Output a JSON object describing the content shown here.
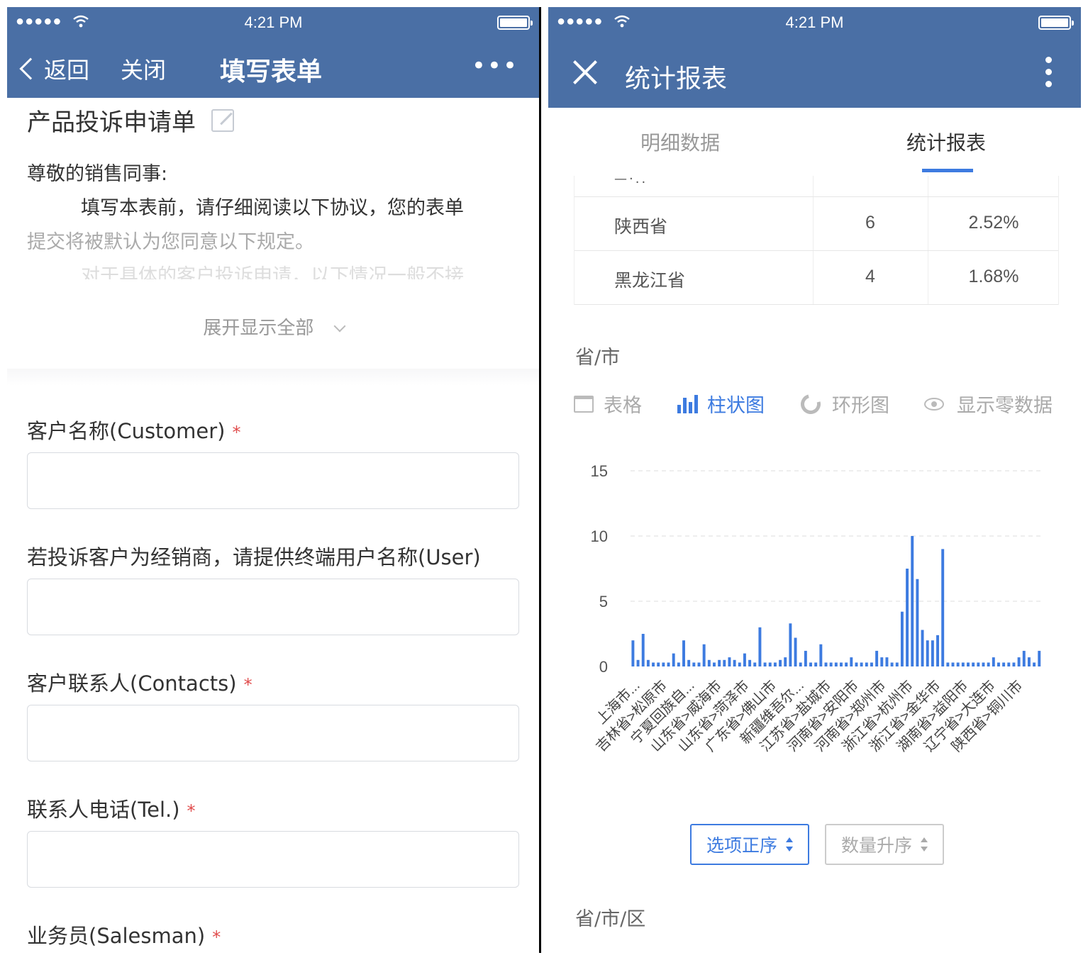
{
  "left": {
    "status": {
      "signal": "●●●●●",
      "time": "4:21 PM"
    },
    "nav": {
      "back_label": "返回",
      "close_label": "关闭",
      "title": "填写表单",
      "more_label": "•••"
    },
    "form_title": "产品投诉申请单",
    "intro": {
      "greeting": "尊敬的销售同事:",
      "line1": "填写本表前，请仔细阅读以下协议，您的表单",
      "line2": "提交将被默认为您同意以下规定。",
      "line3": "对于具体的客户投诉申请，以下情况一般不接"
    },
    "expand_label": "展开显示全部",
    "fields": [
      {
        "label": "客户名称(Customer)",
        "required": "*"
      },
      {
        "label": "若投诉客户为经销商，请提供终端用户名称(User)",
        "required": ""
      },
      {
        "label": "客户联系人(Contacts)",
        "required": "*"
      },
      {
        "label": "联系人电话(Tel.)",
        "required": "*"
      },
      {
        "label": "业务员(Salesman)",
        "required": "*"
      }
    ]
  },
  "right": {
    "status": {
      "signal": "●●●●●",
      "time": "4:21 PM"
    },
    "nav": {
      "title": "统计报表"
    },
    "tabs": [
      {
        "label": "明细数据"
      },
      {
        "label": "统计报表"
      }
    ],
    "table_rows": [
      {
        "province": "陕西省",
        "count": "6",
        "percent": "2.52%"
      },
      {
        "province": "黑龙江省",
        "count": "4",
        "percent": "1.68%"
      }
    ],
    "section1_title": "省/市",
    "view_options": [
      "表格",
      "柱状图",
      "环形图",
      "显示零数据"
    ],
    "section2_title": "省/市/区",
    "sort_buttons": {
      "option_order": "选项正序",
      "count_asc": "数量升序"
    },
    "colors": {
      "accent": "#3d7be0",
      "nav": "#4a6fa5",
      "required": "#e04b4b"
    }
  },
  "chart_data": {
    "type": "bar",
    "ylim": [
      0,
      15
    ],
    "yticks": [
      0,
      5,
      10,
      15
    ],
    "grid": true,
    "x_tick_labels": [
      "上海市...",
      "吉林省>松原市",
      "宁夏回族自...",
      "山东省>威海市",
      "山东省>菏泽市",
      "广东省>佛山市",
      "新疆维吾尔...",
      "江苏省>盐城市",
      "河南省>安阳市",
      "河南省>郑州市",
      "浙江省>杭州市",
      "浙江省>金华市",
      "湖南省>益阳市",
      "辽宁省>大连市",
      "陕西省>铜川市"
    ],
    "values": [
      2,
      0.5,
      2.5,
      0.5,
      0.3,
      0.3,
      0.3,
      0.3,
      1,
      0.3,
      2,
      0.5,
      0.3,
      0.3,
      1.7,
      0.5,
      0.3,
      0.5,
      0.5,
      0.7,
      0.5,
      0.3,
      1,
      0.5,
      0.3,
      3,
      0.3,
      0.3,
      0.3,
      0.5,
      0.7,
      3.3,
      2.2,
      0.3,
      1.2,
      0.3,
      0.3,
      1.7,
      0.3,
      0.3,
      0.3,
      0.3,
      0.3,
      0.7,
      0.3,
      0.3,
      0.3,
      0.3,
      1.2,
      0.7,
      0.7,
      0.3,
      0.3,
      4.2,
      7.5,
      10,
      6.7,
      2.8,
      2,
      2,
      2.4,
      9,
      0.3,
      0.3,
      0.3,
      0.3,
      0.3,
      0.3,
      0.3,
      0.3,
      0.3,
      0.7,
      0.3,
      0.3,
      0.3,
      0.3,
      0.7,
      1.2,
      0.7,
      0.3,
      1.2
    ]
  }
}
